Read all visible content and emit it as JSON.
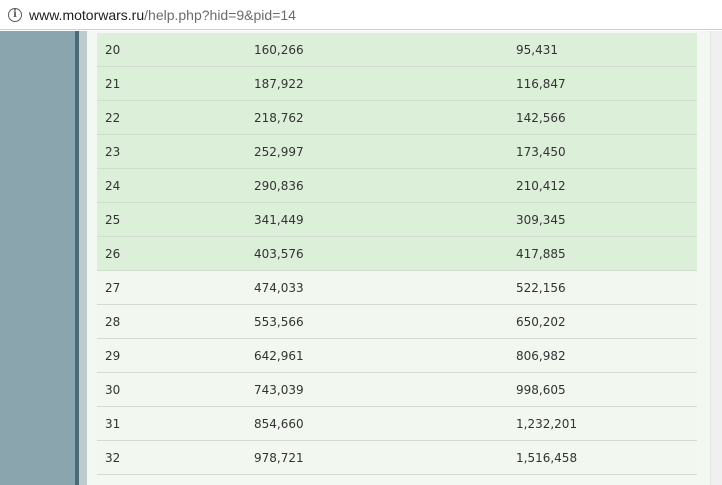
{
  "browser": {
    "url_host": "www.motorwars.ru",
    "url_path": "/help.php?hid=9&pid=14"
  },
  "table": {
    "rows": [
      {
        "level": "20",
        "col2": "160,266",
        "col3": "95,431",
        "highlight": true
      },
      {
        "level": "21",
        "col2": "187,922",
        "col3": "116,847",
        "highlight": true
      },
      {
        "level": "22",
        "col2": "218,762",
        "col3": "142,566",
        "highlight": true
      },
      {
        "level": "23",
        "col2": "252,997",
        "col3": "173,450",
        "highlight": true
      },
      {
        "level": "24",
        "col2": "290,836",
        "col3": "210,412",
        "highlight": true
      },
      {
        "level": "25",
        "col2": "341,449",
        "col3": "309,345",
        "highlight": true
      },
      {
        "level": "26",
        "col2": "403,576",
        "col3": "417,885",
        "highlight": true
      },
      {
        "level": "27",
        "col2": "474,033",
        "col3": "522,156",
        "highlight": false
      },
      {
        "level": "28",
        "col2": "553,566",
        "col3": "650,202",
        "highlight": false
      },
      {
        "level": "29",
        "col2": "642,961",
        "col3": "806,982",
        "highlight": false
      },
      {
        "level": "30",
        "col2": "743,039",
        "col3": "998,605",
        "highlight": false
      },
      {
        "level": "31",
        "col2": "854,660",
        "col3": "1,232,201",
        "highlight": false
      },
      {
        "level": "32",
        "col2": "978,721",
        "col3": "1,516,458",
        "highlight": false
      }
    ]
  },
  "colors": {
    "highlight_row": "#dcefd9",
    "plain_row": "#f2f7ef",
    "sidebar": "#8aa5ad"
  },
  "icons": {
    "address_bar": "info-icon"
  }
}
